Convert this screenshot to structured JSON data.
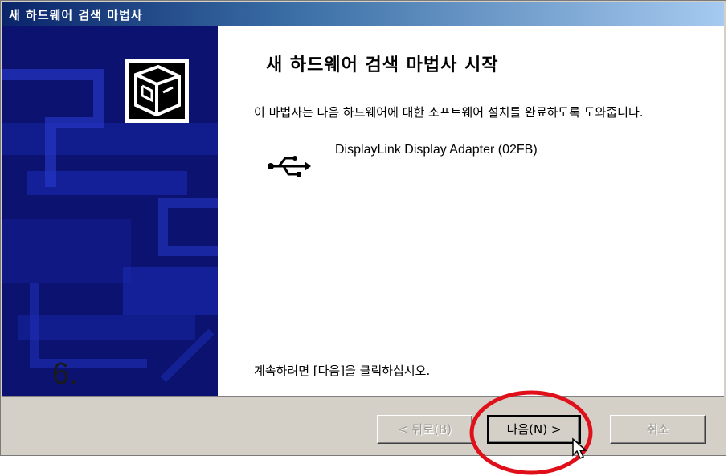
{
  "window": {
    "title": "새 하드웨어 검색 마법사"
  },
  "main": {
    "heading": "새 하드웨어 검색 마법사 시작",
    "description": "이 마법사는 다음 하드웨어에 대한 소프트웨어 설치를 완료하도록 도와줍니다.",
    "device_name": "DisplayLink Display Adapter (02FB)",
    "device_icon": "usb-icon",
    "continue_text": "계속하려면 [다음]을 클릭하십시오."
  },
  "sidebar": {
    "step_number": "6."
  },
  "buttons": {
    "back_label": "< 뒤로(B)",
    "next_label": "다음(N) >",
    "cancel_label": "취소"
  },
  "colors": {
    "sidebar_bg": "#0b1270",
    "highlight_ring": "#e0101a",
    "titlebar_start": "#0a246a",
    "titlebar_end": "#a6caf0"
  }
}
